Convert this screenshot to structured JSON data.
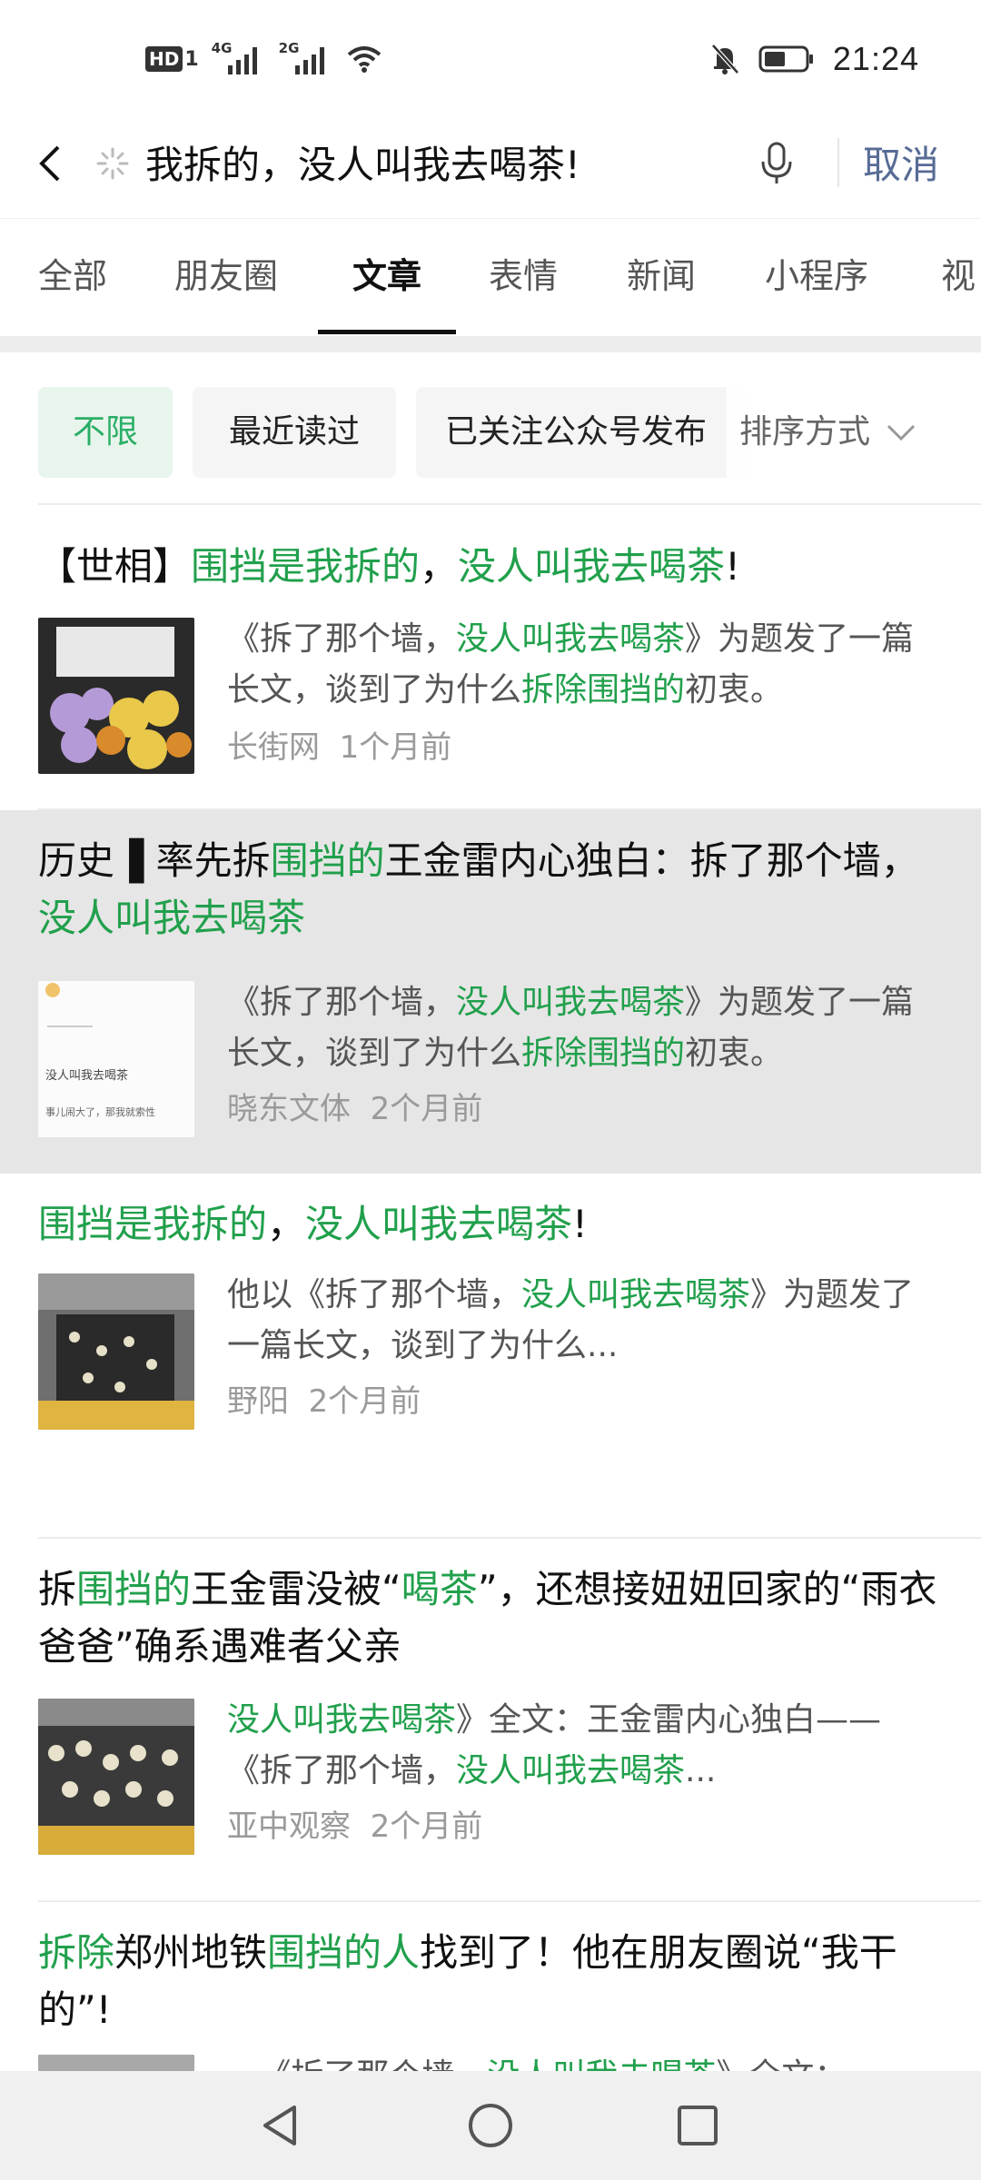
{
  "status_bar": {
    "hd_badge": "HD",
    "sim_index": "1",
    "sim1_net": "4G",
    "sim2_net": "2G",
    "wifi_icon": "wifi-icon",
    "mute_icon": "bell-off-icon",
    "battery_icon": "battery-icon",
    "time": "21:24"
  },
  "search": {
    "query": "我拆的，没人叫我去喝茶!",
    "cancel_label": "取消",
    "back_icon": "chevron-left-icon",
    "loading_icon": "spinner-icon",
    "mic_icon": "microphone-icon"
  },
  "tabs": [
    {
      "label": "全部"
    },
    {
      "label": "朋友圈"
    },
    {
      "label": "文章",
      "active": true
    },
    {
      "label": "表情"
    },
    {
      "label": "新闻"
    },
    {
      "label": "小程序"
    },
    {
      "label": "视"
    }
  ],
  "filters": {
    "chips": [
      "不限",
      "最近读过",
      "已关注公众号发布"
    ],
    "sort_label": "排序方式"
  },
  "colors": {
    "highlight": "#21a04c",
    "active_chip_bg": "#e8f5ec",
    "cancel": "#576b95"
  },
  "results": [
    {
      "title": [
        "【世相】",
        {
          "h": "围挡是我拆的"
        },
        "，",
        {
          "h": "没人叫我去喝茶"
        },
        "!"
      ],
      "desc": [
        "《拆了那个墙，",
        {
          "h": "没人叫我去喝茶"
        },
        "》为题发了一篇长文，谈到了为什么",
        {
          "h": "拆除围挡的"
        },
        "初衷。"
      ],
      "source": "长街网",
      "time": "1个月前"
    },
    {
      "title": [
        "历史▐ 率先拆",
        {
          "h": "围挡的"
        },
        "王金雷内心独白：拆了那个墙，",
        {
          "h": "没人叫我去喝茶"
        }
      ],
      "desc": [
        "《拆了那个墙，",
        {
          "h": "没人叫我去喝茶"
        },
        "》为题发了一篇长文，谈到了为什么",
        {
          "h": "拆除围挡的"
        },
        "初衷。"
      ],
      "thumb_text": [
        "没人叫我去喝茶",
        "事儿闹大了，那我就索性"
      ],
      "source": "晓东文体",
      "time": "2个月前"
    },
    {
      "title": [
        {
          "h": "围挡是我拆的"
        },
        "，",
        {
          "h": "没人叫我去喝茶"
        },
        "!"
      ],
      "desc": [
        "他以《拆了那个墙，",
        {
          "h": "没人叫我去喝茶"
        },
        "》为题发了一篇长文，谈到了为什么..."
      ],
      "source": "野阳",
      "time": "2个月前"
    },
    {
      "title": [
        "拆",
        {
          "h": "围挡的"
        },
        "王金雷没被“",
        {
          "h": "喝茶"
        },
        "”，还想接妞妞回家的“雨衣爸爸”确系遇难者父亲"
      ],
      "desc": [
        {
          "h": "没人叫我去喝茶"
        },
        "》全文：王金雷内心独白——《拆了那个墙，",
        {
          "h": "没人叫我去喝茶"
        },
        "..."
      ],
      "source": "亚中观察",
      "time": "2个月前"
    },
    {
      "title": [
        {
          "h": "拆除"
        },
        "郑州地铁",
        {
          "h": "围挡的人"
        },
        "找到了！他在朋友圈说“我干的”!"
      ],
      "desc": [
        "...《拆了那个墙，",
        {
          "h": "没人叫我去喝茶"
        },
        "》全文："
      ],
      "source": "",
      "time": ""
    }
  ],
  "navbar": {
    "back_icon": "triangle-back-icon",
    "home_icon": "circle-home-icon",
    "recents_icon": "square-recents-icon"
  }
}
